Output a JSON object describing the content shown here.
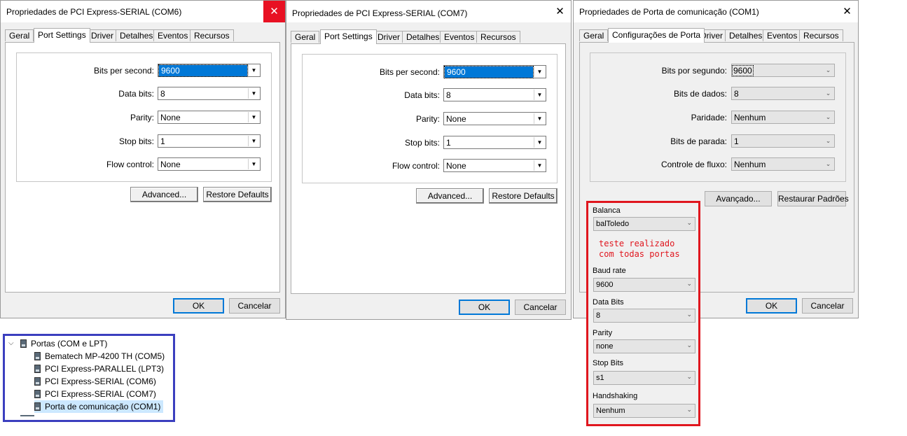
{
  "dialog1": {
    "title": "Propriedades de PCI Express-SERIAL (COM6)",
    "close": "✕",
    "tabs": [
      "Geral",
      "Port Settings",
      "Driver",
      "Detalhes",
      "Eventos",
      "Recursos"
    ],
    "active_tab": "Port Settings",
    "fields": [
      {
        "label": "Bits per second:",
        "value": "9600"
      },
      {
        "label": "Data bits:",
        "value": "8"
      },
      {
        "label": "Parity:",
        "value": "None"
      },
      {
        "label": "Stop bits:",
        "value": "1"
      },
      {
        "label": "Flow control:",
        "value": "None"
      }
    ],
    "advanced": "Advanced...",
    "restore": "Restore Defaults",
    "ok": "OK",
    "cancel": "Cancelar"
  },
  "dialog2": {
    "title": "Propriedades de PCI Express-SERIAL (COM7)",
    "close": "✕",
    "tabs": [
      "Geral",
      "Port Settings",
      "Driver",
      "Detalhes",
      "Eventos",
      "Recursos"
    ],
    "active_tab": "Port Settings",
    "fields": [
      {
        "label": "Bits per second:",
        "value": "9600"
      },
      {
        "label": "Data bits:",
        "value": "8"
      },
      {
        "label": "Parity:",
        "value": "None"
      },
      {
        "label": "Stop bits:",
        "value": "1"
      },
      {
        "label": "Flow control:",
        "value": "None"
      }
    ],
    "advanced": "Advanced...",
    "restore": "Restore Defaults",
    "ok": "OK",
    "cancel": "Cancelar"
  },
  "dialog3": {
    "title": "Propriedades de Porta de comunicação (COM1)",
    "close": "✕",
    "tabs": [
      "Geral",
      "Configurações de Porta",
      "Driver",
      "Detalhes",
      "Eventos",
      "Recursos"
    ],
    "active_tab": "Configurações de Porta",
    "fields": [
      {
        "label": "Bits por segundo:",
        "value": "9600"
      },
      {
        "label": "Bits de dados:",
        "value": "8"
      },
      {
        "label": "Paridade:",
        "value": "Nenhum"
      },
      {
        "label": "Bits de parada:",
        "value": "1"
      },
      {
        "label": "Controle de fluxo:",
        "value": "Nenhum"
      }
    ],
    "advanced": "Avançado...",
    "restore": "Restaurar Padrões",
    "ok": "OK",
    "cancel": "Cancelar"
  },
  "app_settings": {
    "fields": [
      {
        "label": "Balanca",
        "value": "balToledo"
      },
      {
        "label": "Baud rate",
        "value": "9600"
      },
      {
        "label": "Data Bits",
        "value": "8"
      },
      {
        "label": "Parity",
        "value": "none"
      },
      {
        "label": "Stop Bits",
        "value": "s1"
      },
      {
        "label": "Handshaking",
        "value": "Nenhum"
      }
    ],
    "note": "teste realizado\ncom todas portas",
    "note_color": "#e0161e",
    "border_color": "#e0161e"
  },
  "device_tree": {
    "group": "Portas (COM e LPT)",
    "items": [
      "Bematech MP-4200 TH (COM5)",
      "PCI Express-PARALLEL (LPT3)",
      "PCI Express-SERIAL (COM6)",
      "PCI Express-SERIAL (COM7)",
      "Porta de comunicação (COM1)"
    ],
    "selected": "Porta de comunicação (COM1)",
    "border_color": "#3b3fbf"
  },
  "icons": {
    "close": "close-icon",
    "dropdown": "chevron-down-icon",
    "tree_expand": "chevron-down-icon",
    "device": "port-device-icon"
  }
}
